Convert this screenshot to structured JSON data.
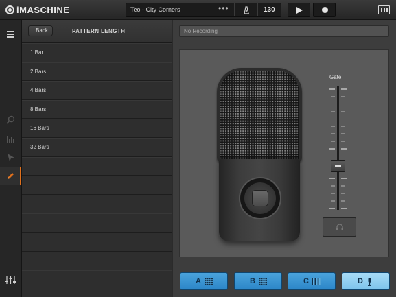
{
  "app": {
    "name": "iMASCHINE"
  },
  "transport": {
    "song_title": "Teo - City Corners",
    "more": "•••",
    "tempo": "130"
  },
  "pattern_panel": {
    "back_label": "Back",
    "title": "PATTERN LENGTH",
    "items": [
      "1 Bar",
      "2 Bars",
      "4 Bars",
      "8 Bars",
      "16 Bars",
      "32 Bars",
      "",
      "",
      "",
      "",
      "",
      "",
      ""
    ]
  },
  "recorder": {
    "status": "No Recording",
    "gate_label": "Gate",
    "gate_level": 0.35
  },
  "groups": [
    {
      "label": "A",
      "icon": "pads-icon",
      "active": false
    },
    {
      "label": "B",
      "icon": "pads-icon",
      "active": false
    },
    {
      "label": "C",
      "icon": "keyboard-icon",
      "active": false
    },
    {
      "label": "D",
      "icon": "microphone-icon",
      "active": true
    }
  ],
  "colors": {
    "accent": "#e0701c",
    "group_blue": "#3c97d4",
    "group_active": "#94d0f2"
  }
}
